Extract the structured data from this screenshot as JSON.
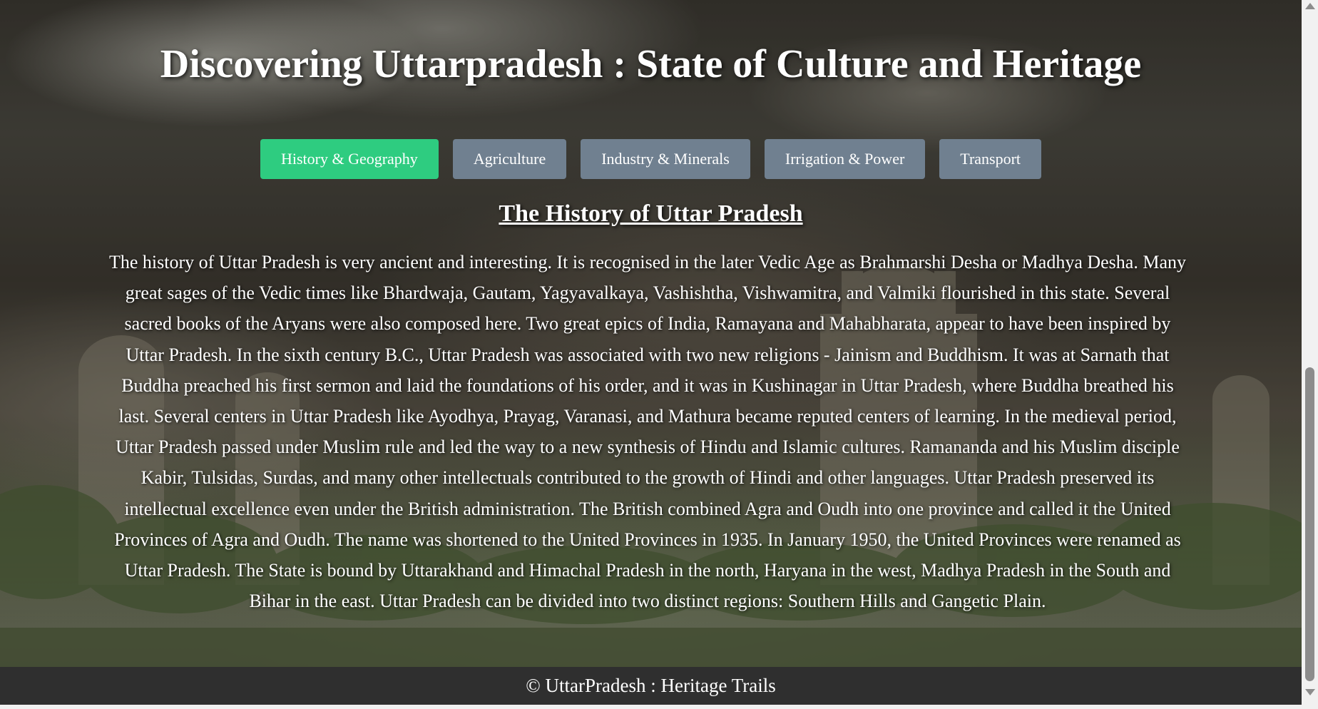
{
  "header": {
    "title": "Discovering Uttarpradesh : State of Culture and Heritage"
  },
  "tabs": [
    {
      "label": "History & Geography",
      "active": true
    },
    {
      "label": "Agriculture",
      "active": false
    },
    {
      "label": "Industry & Minerals",
      "active": false
    },
    {
      "label": "Irrigation & Power",
      "active": false
    },
    {
      "label": "Transport",
      "active": false
    }
  ],
  "main": {
    "section_title": "The History of Uttar Pradesh",
    "body": "The history of Uttar Pradesh is very ancient and interesting. It is recognised in the later Vedic Age as Brahmarshi Desha or Madhya Desha. Many great sages of the Vedic times like Bhardwaja, Gautam, Yagyavalkaya, Vashishtha, Vishwamitra, and Valmiki flourished in this state. Several sacred books of the Aryans were also composed here. Two great epics of India, Ramayana and Mahabharata, appear to have been inspired by Uttar Pradesh. In the sixth century B.C., Uttar Pradesh was associated with two new religions - Jainism and Buddhism. It was at Sarnath that Buddha preached his first sermon and laid the foundations of his order, and it was in Kushinagar in Uttar Pradesh, where Buddha breathed his last. Several centers in Uttar Pradesh like Ayodhya, Prayag, Varanasi, and Mathura became reputed centers of learning. In the medieval period, Uttar Pradesh passed under Muslim rule and led the way to a new synthesis of Hindu and Islamic cultures. Ramananda and his Muslim disciple Kabir, Tulsidas, Surdas, and many other intellectuals contributed to the growth of Hindi and other languages. Uttar Pradesh preserved its intellectual excellence even under the British administration. The British combined Agra and Oudh into one province and called it the United Provinces of Agra and Oudh. The name was shortened to the United Provinces in 1935. In January 1950, the United Provinces were renamed as Uttar Pradesh. The State is bound by Uttarakhand and Himachal Pradesh in the north, Haryana in the west, Madhya Pradesh in the South and Bihar in the east. Uttar Pradesh can be divided into two distinct regions: Southern Hills and Gangetic Plain."
  },
  "footer": {
    "text": "© UttarPradesh : Heritage Trails"
  },
  "colors": {
    "active_tab": "#2ecc80",
    "inactive_tab": "#708090",
    "footer_bg": "#2f2f2f",
    "text": "#ffffff"
  }
}
